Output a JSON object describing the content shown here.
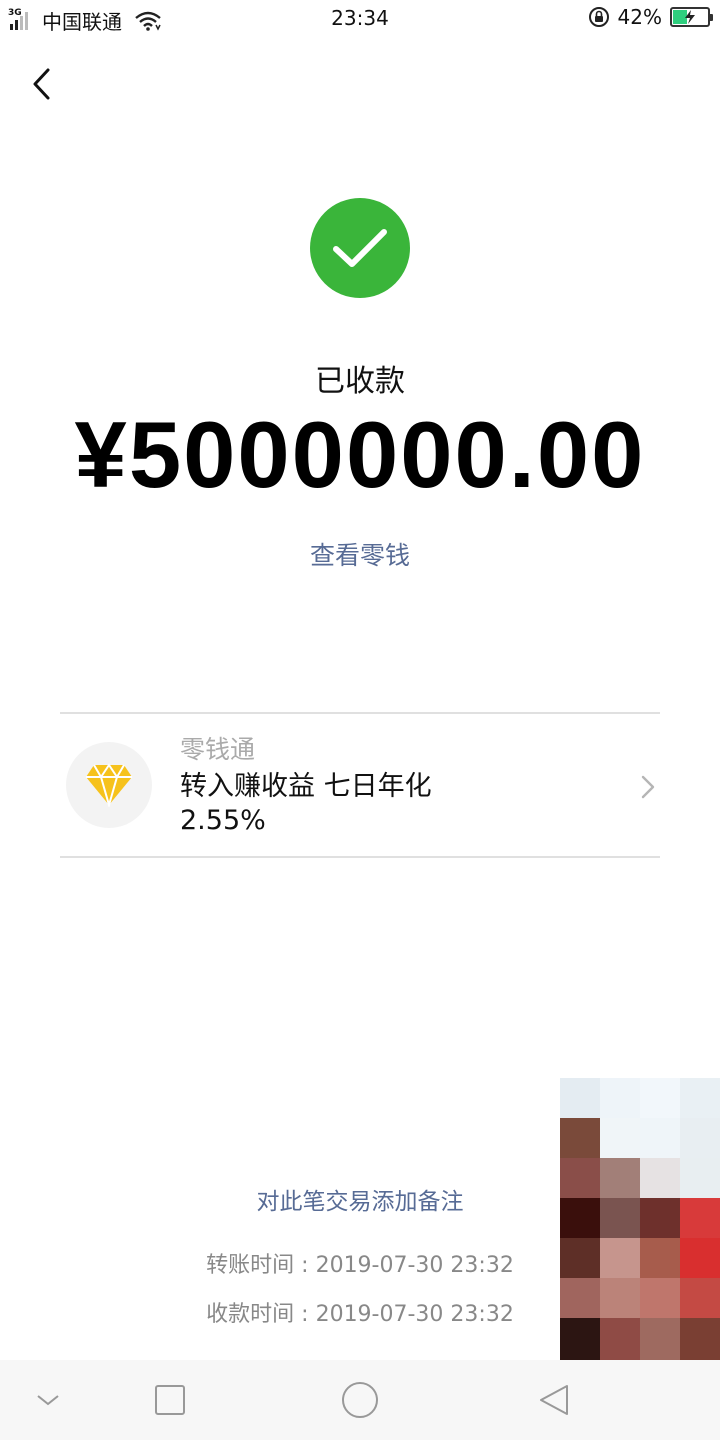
{
  "status_bar": {
    "network": "3G",
    "carrier": "中国联通",
    "time": "23:34",
    "battery_percent": "42%",
    "battery_level": 0.42,
    "battery_color": "#2ecf7e"
  },
  "nav": {
    "back_icon": "chevron-left-icon"
  },
  "result": {
    "icon": "checkmark-icon",
    "icon_color": "#3ab53a",
    "status": "已收款",
    "amount": "¥5000000.00",
    "view_change_link": "查看零钱",
    "link_color": "#576b95"
  },
  "promo": {
    "icon": "diamond-icon",
    "title": "零钱通",
    "description": "转入赚收益 七日年化 2.55%"
  },
  "footer": {
    "add_note_link": "对此笔交易添加备注",
    "transfer_time": "转账时间 : 2019-07-30 23:32",
    "receive_time": "收款时间 : 2019-07-30 23:32"
  },
  "system_nav": {
    "buttons": [
      "chevron-down-icon",
      "square-icon",
      "circle-icon",
      "triangle-back-icon"
    ]
  }
}
